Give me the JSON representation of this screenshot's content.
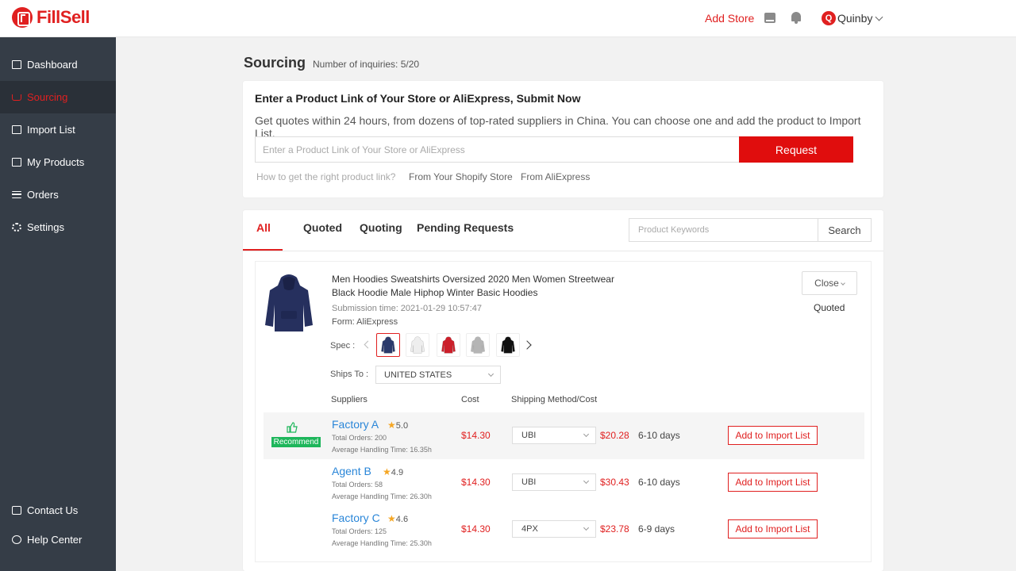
{
  "brand": {
    "name": "FillSell",
    "color": "#e02020"
  },
  "topbar": {
    "add_store": "Add Store",
    "user_initial": "Q",
    "user_name": "Quinby"
  },
  "sidebar": {
    "items": [
      {
        "label": "Dashboard",
        "icon": "dashboard-icon",
        "active": false
      },
      {
        "label": "Sourcing",
        "icon": "cart-icon",
        "active": true
      },
      {
        "label": "Import List",
        "icon": "import-icon",
        "active": false
      },
      {
        "label": "My Products",
        "icon": "products-icon",
        "active": false
      },
      {
        "label": "Orders",
        "icon": "orders-icon",
        "active": false
      },
      {
        "label": "Settings",
        "icon": "gear-icon",
        "active": false
      }
    ],
    "bottom": [
      {
        "label": "Contact Us",
        "icon": "chat-icon"
      },
      {
        "label": "Help Center",
        "icon": "help-icon"
      }
    ]
  },
  "page": {
    "title": "Sourcing",
    "inquiries": "Number of inquiries: 5/20"
  },
  "request": {
    "title": "Enter a Product Link of Your Store or AliExpress, Submit Now",
    "description": "Get quotes within 24 hours, from dozens of top-rated suppliers in China. You can choose one and add the product to Import List.",
    "placeholder": "Enter a Product Link of Your Store or AliExpress",
    "button": "Request",
    "help": "How to get the right product link?",
    "link_shopify": "From Your Shopify Store",
    "link_aliexpress": "From AliExpress"
  },
  "tabs": [
    "All",
    "Quoted",
    "Quoting",
    "Pending Requests"
  ],
  "search": {
    "placeholder": "Product Keywords",
    "button": "Search"
  },
  "item": {
    "title": "Men Hoodies Sweatshirts Oversized 2020 Men Women Streetwear Black Hoodie Male Hiphop Winter Basic Hoodies",
    "submission_time": "Submission time: 2021-01-29 10:57:47",
    "form": "Form: AliExpress",
    "close_button": "Close",
    "status": "Quoted",
    "spec_label": "Spec :",
    "swatch_colors": [
      "#2b3a6b",
      "#eeeeee",
      "#cc1f2a",
      "#b5b5b5",
      "#111111"
    ],
    "ships_to_label": "Ships To :",
    "ships_to_value": "UNITED STATES",
    "headers": {
      "suppliers": "Suppliers",
      "cost": "Cost",
      "shipping": "Shipping Method/Cost"
    },
    "recommend_label": "Recommend",
    "suppliers": [
      {
        "name": "Factory A",
        "rating": "5.0",
        "orders": "Total Orders: 200",
        "handling": "Average Handling Time: 16.35h",
        "cost": "$14.30",
        "method": "UBI",
        "ship_cost": "$20.28",
        "days": "6-10 days",
        "action": "Add to Import List"
      },
      {
        "name": "Agent B",
        "rating": "4.9",
        "orders": "Total Orders: 58",
        "handling": "Average Handling Time: 26.30h",
        "cost": "$14.30",
        "method": "UBI",
        "ship_cost": "$30.43",
        "days": "6-10 days",
        "action": "Add to Import List"
      },
      {
        "name": "Factory C",
        "rating": "4.6",
        "orders": "Total Orders: 125",
        "handling": "Average Handling Time: 25.30h",
        "cost": "$14.30",
        "method": "4PX",
        "ship_cost": "$23.78",
        "days": "6-9 days",
        "action": "Add to Import List"
      }
    ]
  }
}
